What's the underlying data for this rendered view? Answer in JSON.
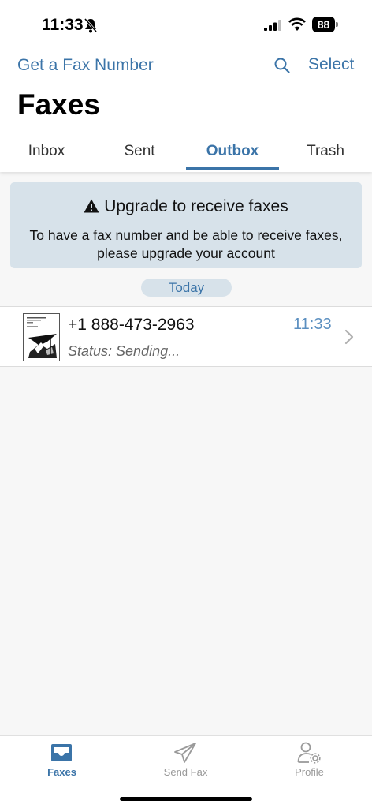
{
  "status_bar": {
    "time": "11:33",
    "battery": "88"
  },
  "header": {
    "get_fax_number": "Get a Fax Number",
    "select": "Select",
    "title": "Faxes"
  },
  "tabs": [
    {
      "label": "Inbox",
      "active": false
    },
    {
      "label": "Sent",
      "active": false
    },
    {
      "label": "Outbox",
      "active": true
    },
    {
      "label": "Trash",
      "active": false
    }
  ],
  "banner": {
    "title": "Upgrade to receive faxes",
    "body_line1": "To have a fax number and be able to receive faxes,",
    "body_line2": "please upgrade your account"
  },
  "section_date": "Today",
  "faxes": [
    {
      "number": "+1 888-473-2963",
      "status": "Status: Sending...",
      "time": "11:33"
    }
  ],
  "tab_bar": [
    {
      "label": "Faxes",
      "icon": "inbox-tray-icon",
      "active": true
    },
    {
      "label": "Send Fax",
      "icon": "paper-plane-icon",
      "active": false
    },
    {
      "label": "Profile",
      "icon": "user-settings-icon",
      "active": false
    }
  ],
  "colors": {
    "accent": "#3b74a8",
    "banner_bg": "#d7e2ea",
    "background": "#f7f7f7"
  }
}
